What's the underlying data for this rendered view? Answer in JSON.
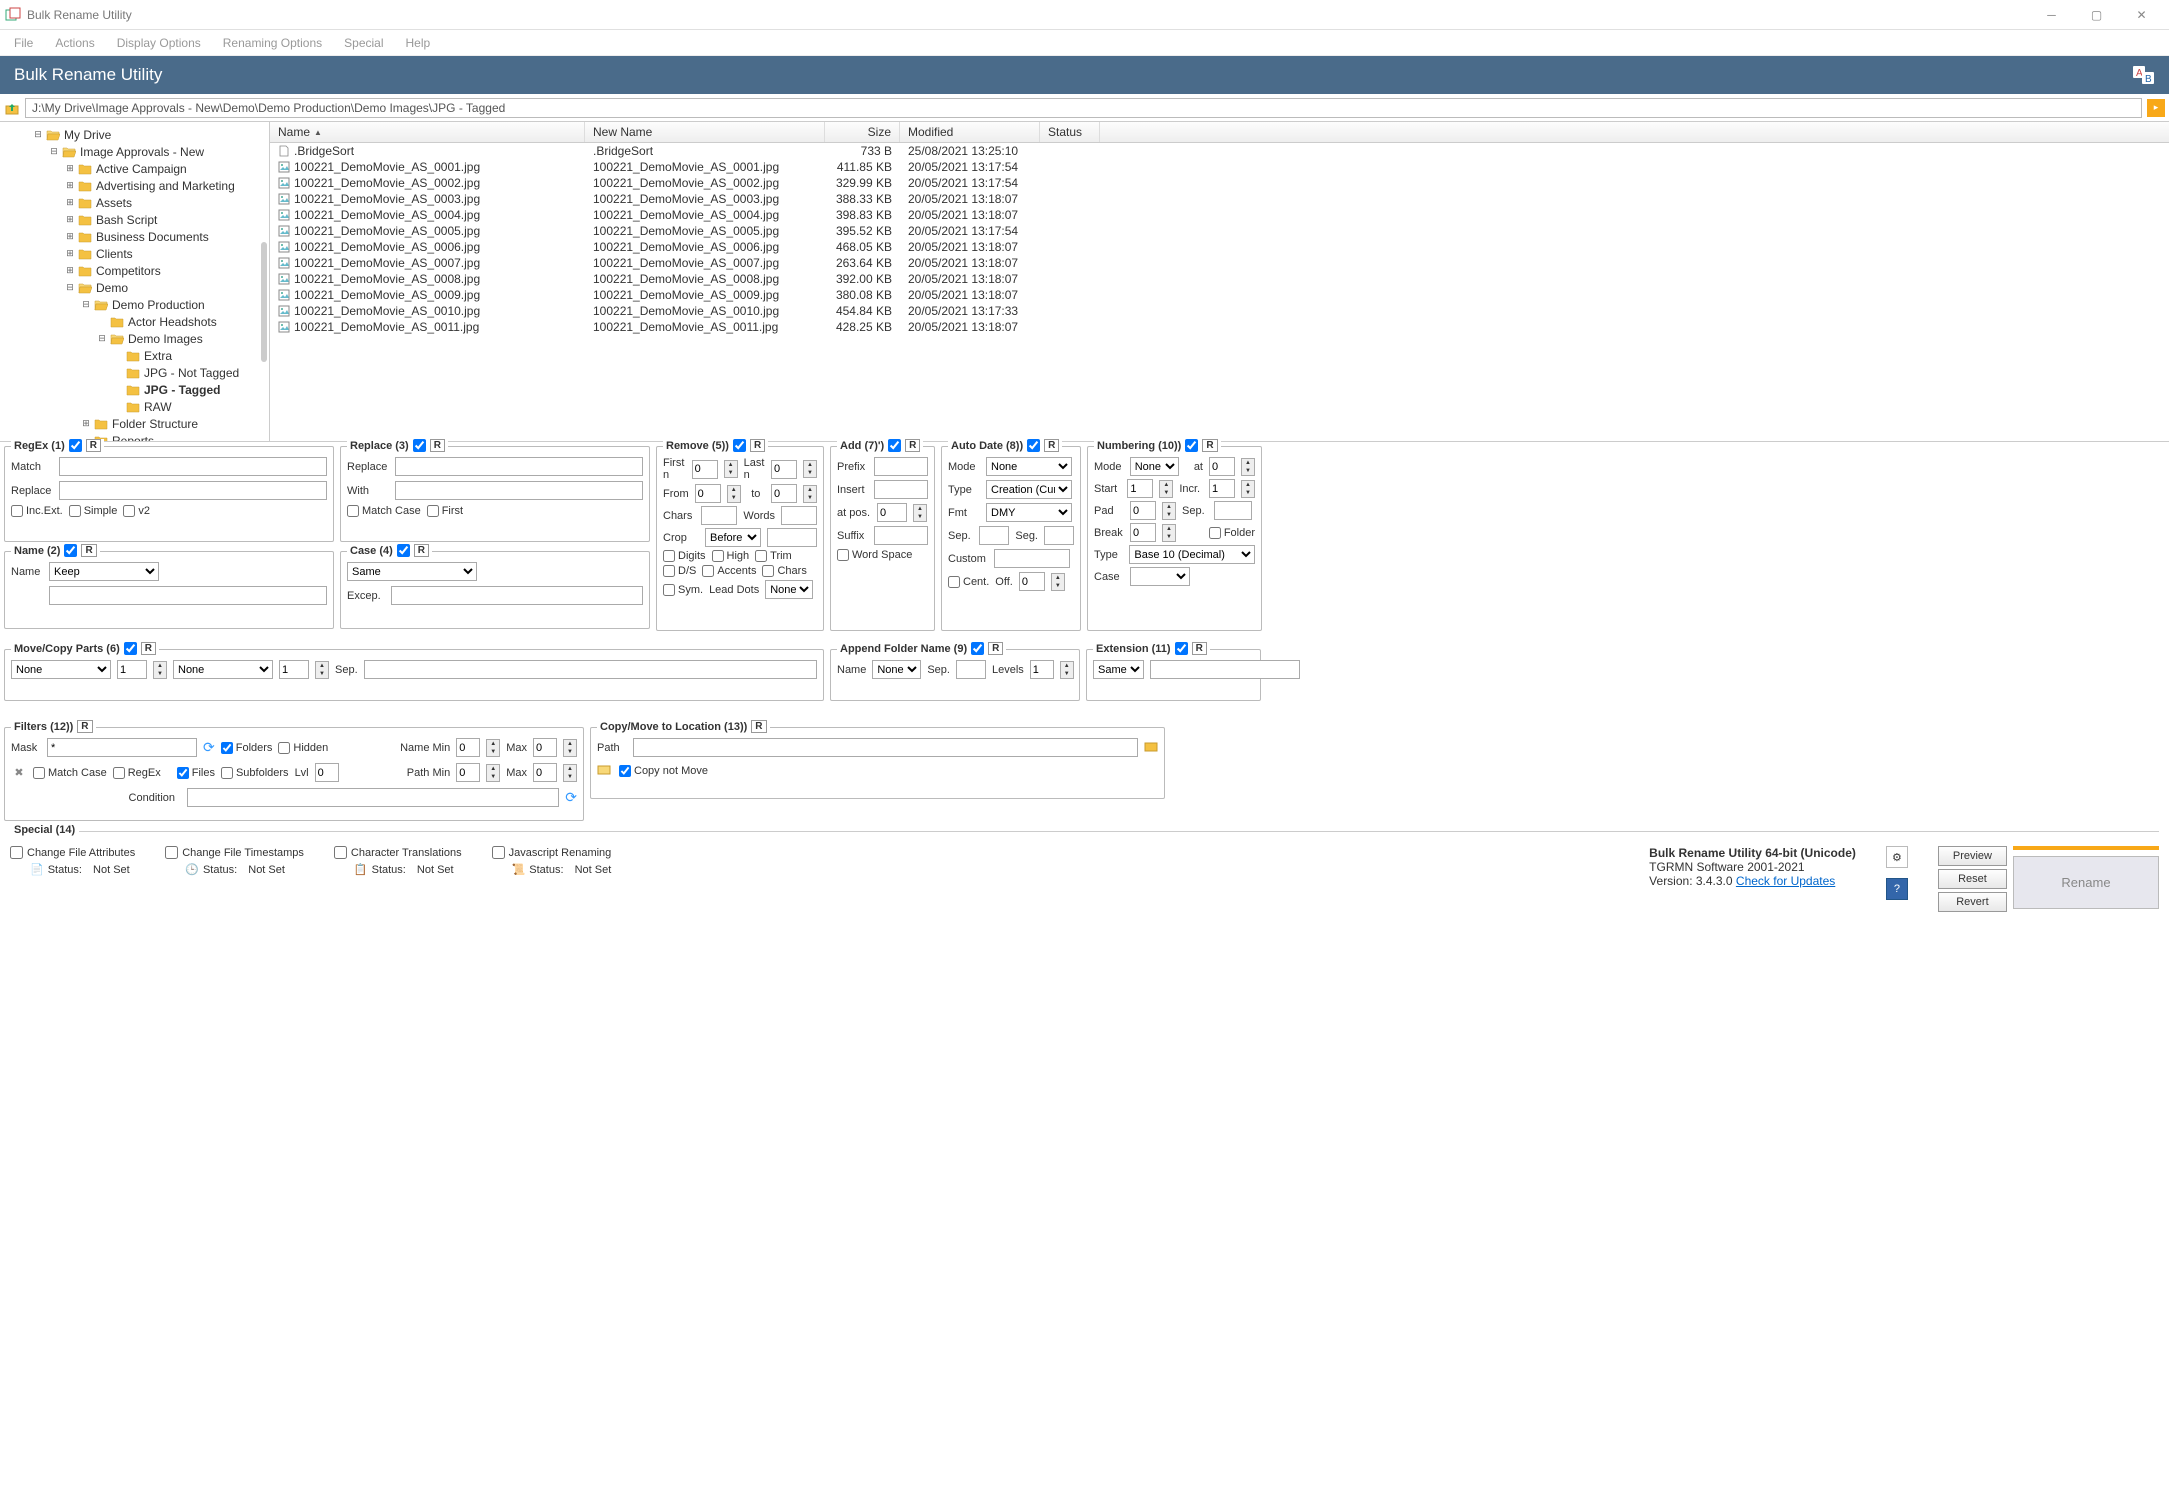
{
  "window": {
    "title": "Bulk Rename Utility"
  },
  "menus": [
    "File",
    "Actions",
    "Display Options",
    "Renaming Options",
    "Special",
    "Help"
  ],
  "banner": {
    "title": "Bulk Rename Utility"
  },
  "path": "J:\\My Drive\\Image Approvals - New\\Demo\\Demo Production\\Demo Images\\JPG - Tagged",
  "tree": [
    {
      "indent": 0,
      "expand": "-",
      "icon": "folder-open",
      "label": "My Drive"
    },
    {
      "indent": 1,
      "expand": "-",
      "icon": "folder-open",
      "label": "Image Approvals - New"
    },
    {
      "indent": 2,
      "expand": "+",
      "icon": "folder",
      "label": "Active Campaign"
    },
    {
      "indent": 2,
      "expand": "+",
      "icon": "folder",
      "label": "Advertising and Marketing"
    },
    {
      "indent": 2,
      "expand": "+",
      "icon": "folder",
      "label": "Assets"
    },
    {
      "indent": 2,
      "expand": "+",
      "icon": "folder",
      "label": "Bash Script"
    },
    {
      "indent": 2,
      "expand": "+",
      "icon": "folder",
      "label": "Business Documents"
    },
    {
      "indent": 2,
      "expand": "+",
      "icon": "folder",
      "label": "Clients"
    },
    {
      "indent": 2,
      "expand": "+",
      "icon": "folder",
      "label": "Competitors"
    },
    {
      "indent": 2,
      "expand": "-",
      "icon": "folder-open",
      "label": "Demo"
    },
    {
      "indent": 3,
      "expand": "-",
      "icon": "folder-open",
      "label": "Demo Production"
    },
    {
      "indent": 4,
      "expand": "",
      "icon": "folder",
      "label": "Actor Headshots"
    },
    {
      "indent": 4,
      "expand": "-",
      "icon": "folder-open",
      "label": "Demo Images"
    },
    {
      "indent": 5,
      "expand": "",
      "icon": "folder",
      "label": "Extra"
    },
    {
      "indent": 5,
      "expand": "",
      "icon": "folder",
      "label": "JPG - Not Tagged"
    },
    {
      "indent": 5,
      "expand": "",
      "icon": "folder",
      "label": "JPG - Tagged",
      "bold": true
    },
    {
      "indent": 5,
      "expand": "",
      "icon": "folder",
      "label": "RAW"
    },
    {
      "indent": 3,
      "expand": "+",
      "icon": "folder",
      "label": "Folder Structure"
    },
    {
      "indent": 3,
      "expand": "",
      "icon": "folder",
      "label": "Reports"
    }
  ],
  "columns": {
    "name": "Name",
    "newname": "New Name",
    "size": "Size",
    "modified": "Modified",
    "status": "Status"
  },
  "files": [
    {
      "icon": "file",
      "name": ".BridgeSort",
      "new": ".BridgeSort",
      "size": "733 B",
      "mod": "25/08/2021 13:25:10"
    },
    {
      "icon": "img",
      "name": "100221_DemoMovie_AS_0001.jpg",
      "new": "100221_DemoMovie_AS_0001.jpg",
      "size": "411.85 KB",
      "mod": "20/05/2021 13:17:54"
    },
    {
      "icon": "img",
      "name": "100221_DemoMovie_AS_0002.jpg",
      "new": "100221_DemoMovie_AS_0002.jpg",
      "size": "329.99 KB",
      "mod": "20/05/2021 13:17:54"
    },
    {
      "icon": "img",
      "name": "100221_DemoMovie_AS_0003.jpg",
      "new": "100221_DemoMovie_AS_0003.jpg",
      "size": "388.33 KB",
      "mod": "20/05/2021 13:18:07"
    },
    {
      "icon": "img",
      "name": "100221_DemoMovie_AS_0004.jpg",
      "new": "100221_DemoMovie_AS_0004.jpg",
      "size": "398.83 KB",
      "mod": "20/05/2021 13:18:07"
    },
    {
      "icon": "img",
      "name": "100221_DemoMovie_AS_0005.jpg",
      "new": "100221_DemoMovie_AS_0005.jpg",
      "size": "395.52 KB",
      "mod": "20/05/2021 13:17:54"
    },
    {
      "icon": "img",
      "name": "100221_DemoMovie_AS_0006.jpg",
      "new": "100221_DemoMovie_AS_0006.jpg",
      "size": "468.05 KB",
      "mod": "20/05/2021 13:18:07"
    },
    {
      "icon": "img",
      "name": "100221_DemoMovie_AS_0007.jpg",
      "new": "100221_DemoMovie_AS_0007.jpg",
      "size": "263.64 KB",
      "mod": "20/05/2021 13:18:07"
    },
    {
      "icon": "img",
      "name": "100221_DemoMovie_AS_0008.jpg",
      "new": "100221_DemoMovie_AS_0008.jpg",
      "size": "392.00 KB",
      "mod": "20/05/2021 13:18:07"
    },
    {
      "icon": "img",
      "name": "100221_DemoMovie_AS_0009.jpg",
      "new": "100221_DemoMovie_AS_0009.jpg",
      "size": "380.08 KB",
      "mod": "20/05/2021 13:18:07"
    },
    {
      "icon": "img",
      "name": "100221_DemoMovie_AS_0010.jpg",
      "new": "100221_DemoMovie_AS_0010.jpg",
      "size": "454.84 KB",
      "mod": "20/05/2021 13:17:33"
    },
    {
      "icon": "img",
      "name": "100221_DemoMovie_AS_0011.jpg",
      "new": "100221_DemoMovie_AS_0011.jpg",
      "size": "428.25 KB",
      "mod": "20/05/2021 13:18:07"
    }
  ],
  "panels": {
    "regex": {
      "title": "RegEx (1)",
      "match": "Match",
      "replace": "Replace",
      "incext": "Inc.Ext.",
      "simple": "Simple",
      "v2": "v2"
    },
    "replace": {
      "title": "Replace (3)",
      "replace": "Replace",
      "with": "With",
      "matchcase": "Match Case",
      "first": "First"
    },
    "name": {
      "title": "Name (2)",
      "label": "Name",
      "value": "Keep"
    },
    "case": {
      "title": "Case (4)",
      "value": "Same",
      "excep": "Excep."
    },
    "remove": {
      "title": "Remove (5))",
      "firstn": "First n",
      "lastn": "Last n",
      "from": "From",
      "to": "to",
      "chars": "Chars",
      "words": "Words",
      "crop": "Crop",
      "cropval": "Before",
      "trim": "Trim",
      "digits": "Digits",
      "high": "High",
      "ds": "D/S",
      "accents": "Accents",
      "chars2": "Chars",
      "sym": "Sym.",
      "leaddots": "Lead Dots",
      "leadval": "None",
      "zero": "0"
    },
    "add": {
      "title": "Add (7)')",
      "prefix": "Prefix",
      "insert": "Insert",
      "atpos": "at pos.",
      "suffix": "Suffix",
      "wordspace": "Word Space",
      "zero": "0"
    },
    "autodate": {
      "title": "Auto Date (8))",
      "mode": "Mode",
      "modeval": "None",
      "type": "Type",
      "typeval": "Creation (Curr",
      "fmt": "Fmt",
      "fmtval": "DMY",
      "sep": "Sep.",
      "seg": "Seg.",
      "custom": "Custom",
      "cent": "Cent.",
      "off": "Off.",
      "zero": "0"
    },
    "numbering": {
      "title": "Numbering (10))",
      "mode": "Mode",
      "modeval": "None",
      "at": "at",
      "start": "Start",
      "startval": "1",
      "incr": "Incr.",
      "incrval": "1",
      "pad": "Pad",
      "padval": "0",
      "sep": "Sep.",
      "break": "Break",
      "breakval": "0",
      "folder": "Folder",
      "type": "Type",
      "typeval": "Base 10 (Decimal)",
      "case": "Case",
      "zero": "0"
    },
    "movecopy": {
      "title": "Move/Copy Parts (6)",
      "none": "None",
      "sep": "Sep.",
      "one": "1"
    },
    "appendfolder": {
      "title": "Append Folder Name (9)",
      "name": "Name",
      "nameval": "None",
      "sep": "Sep.",
      "levels": "Levels",
      "levelsval": "1"
    },
    "extension": {
      "title": "Extension (11)",
      "value": "Same"
    },
    "filters": {
      "title": "Filters (12))",
      "mask": "Mask",
      "maskval": "*",
      "folders": "Folders",
      "hidden": "Hidden",
      "files": "Files",
      "subfolders": "Subfolders",
      "lvl": "Lvl",
      "namemin": "Name Min",
      "max": "Max",
      "pathmin": "Path Min",
      "matchcase": "Match Case",
      "regex": "RegEx",
      "condition": "Condition",
      "zero": "0"
    },
    "copymove": {
      "title": "Copy/Move to Location (13))",
      "path": "Path",
      "copynotmove": "Copy not Move"
    }
  },
  "special": {
    "title": "Special (14)",
    "cfa": "Change File Attributes",
    "cft": "Change File Timestamps",
    "ct": "Character Translations",
    "jr": "Javascript Renaming",
    "status": "Status:",
    "notset": "Not Set"
  },
  "version": {
    "line1": "Bulk Rename Utility 64-bit (Unicode)",
    "line2": "TGRMN Software 2001-2021",
    "line3": "Version: 3.4.3.0",
    "check": "Check for Updates"
  },
  "buttons": {
    "preview": "Preview",
    "reset": "Reset",
    "revert": "Revert",
    "rename": "Rename"
  }
}
